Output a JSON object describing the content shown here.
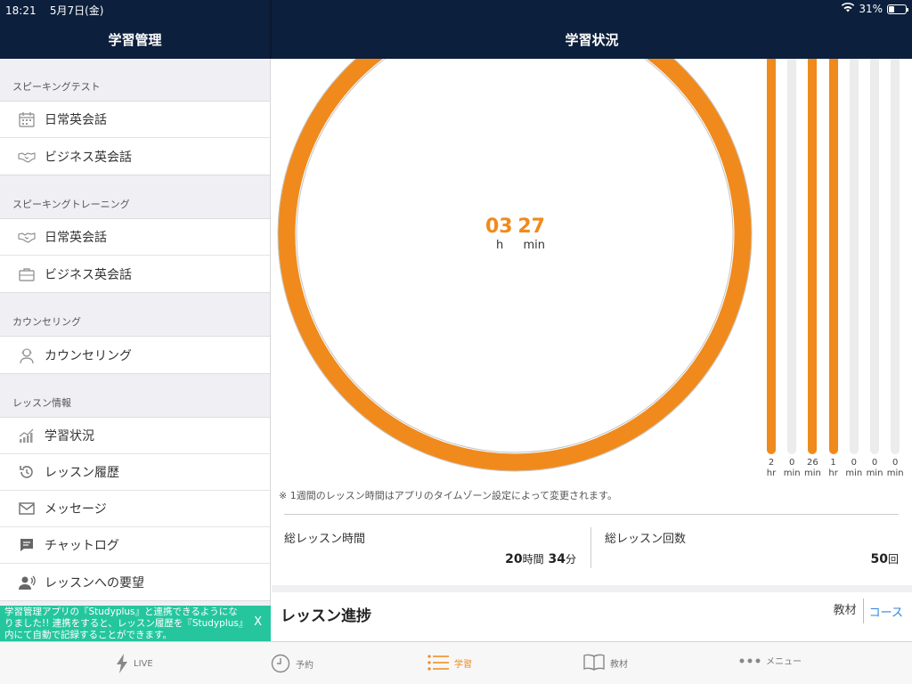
{
  "status": {
    "time": "18:21",
    "date": "5月7日(金)",
    "battery": "31%",
    "battery_level": 0.31
  },
  "sidebar": {
    "title": "学習管理",
    "sections": [
      {
        "label": "スピーキングテスト",
        "items": [
          {
            "label": "日常英会話",
            "icon": "calendar-icon"
          },
          {
            "label": "ビジネス英会話",
            "icon": "handshake-icon"
          }
        ]
      },
      {
        "label": "スピーキングトレーニング",
        "items": [
          {
            "label": "日常英会話",
            "icon": "handshake-icon"
          },
          {
            "label": "ビジネス英会話",
            "icon": "briefcase-icon"
          }
        ]
      },
      {
        "label": "カウンセリング",
        "items": [
          {
            "label": "カウンセリング",
            "icon": "counselor-icon"
          }
        ]
      },
      {
        "label": "レッスン情報",
        "items": [
          {
            "label": "学習状況",
            "icon": "chart-icon"
          },
          {
            "label": "レッスン履歴",
            "icon": "history-icon"
          },
          {
            "label": "メッセージ",
            "icon": "mail-icon"
          },
          {
            "label": "チャットログ",
            "icon": "chat-icon"
          },
          {
            "label": "レッスンへの要望",
            "icon": "request-icon"
          }
        ]
      }
    ]
  },
  "banner": {
    "text": "学習管理アプリの『Studyplus』と連携できるようになりました!! 連携をすると、レッスン履歴を『Studyplus』内にて自動で記録することができます。",
    "close": "X"
  },
  "main": {
    "title": "学習状況",
    "total_time": {
      "hours": "03",
      "minutes": "27",
      "h_unit": "h",
      "min_unit": "min"
    },
    "bars": [
      {
        "value": "2",
        "unit": "hr",
        "level": 1.0
      },
      {
        "value": "0",
        "unit": "min",
        "level": 0
      },
      {
        "value": "26",
        "unit": "min",
        "level": 1.0
      },
      {
        "value": "1",
        "unit": "hr",
        "level": 1.0
      },
      {
        "value": "0",
        "unit": "min",
        "level": 0
      },
      {
        "value": "0",
        "unit": "min",
        "level": 0
      },
      {
        "value": "0",
        "unit": "min",
        "level": 0
      }
    ],
    "note": "※ 1週間のレッスン時間はアプリのタイムゾーン設定によって変更されます。",
    "stats": {
      "total_time_label": "総レッスン時間",
      "total_hours": "20",
      "hours_unit": "時間",
      "total_minutes": "34",
      "minutes_unit": "分",
      "total_count_label": "総レッスン回数",
      "total_count": "50",
      "count_unit": "回"
    },
    "progress": {
      "title": "レッスン進捗",
      "option1": "教材",
      "option2": "コース"
    }
  },
  "tabs": [
    {
      "label": "LIVE",
      "icon": "lightning-icon"
    },
    {
      "label": "予約",
      "icon": "clock-icon"
    },
    {
      "label": "学習",
      "icon": "list-icon",
      "active": true
    },
    {
      "label": "教材",
      "icon": "book-icon"
    },
    {
      "label": "メニュー",
      "icon": "more-icon"
    }
  ],
  "colors": {
    "header": "#0c1f3c",
    "accent": "#f08a1c",
    "banner": "#25c69e",
    "link": "#2e86de"
  }
}
